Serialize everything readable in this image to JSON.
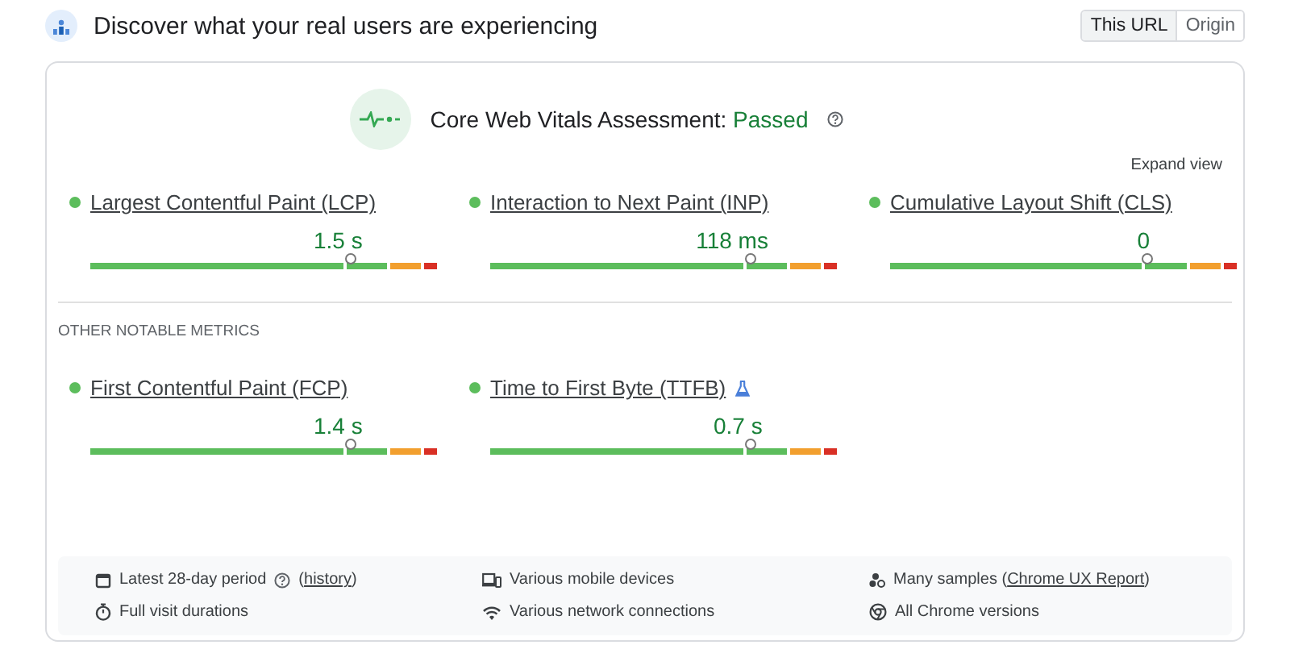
{
  "header": {
    "title": "Discover what your real users are experiencing"
  },
  "toggle": [
    {
      "label": "This URL",
      "selected": true
    },
    {
      "label": "Origin",
      "selected": false
    }
  ],
  "assessment": {
    "label": "Core Web Vitals Assessment:",
    "status": "Passed",
    "passed": true
  },
  "expand_link": "Expand view",
  "core_metrics": [
    {
      "name": "Largest Contentful Paint (LCP)",
      "value": "1.5 s",
      "color": "#5cbd5c",
      "level": 0.75
    },
    {
      "name": "Interaction to Next Paint (INP)",
      "value": "118 ms",
      "color": "#5cbd5c",
      "level": 0.75
    },
    {
      "name": "Cumulative Layout Shift (CLS)",
      "value": "0",
      "color": "#5cbd5c",
      "level": 0.74
    }
  ],
  "other_heading": "OTHER NOTABLE METRICS",
  "other_metrics": [
    {
      "name": "First Contentful Paint (FCP)",
      "value": "1.4 s",
      "color": "#5cbd5c",
      "level": 0.75,
      "experimental": false
    },
    {
      "name": "Time to First Byte (TTFB)",
      "value": "0.7 s",
      "color": "#5cbd5c",
      "level": 0.75,
      "experimental": true
    }
  ],
  "footer": [
    {
      "text": "Latest 28-day period",
      "help": true,
      "before": "(",
      "link": "history",
      "after": ")"
    },
    {
      "text": "Various mobile devices"
    },
    {
      "text": "Many samples (",
      "link": "Chrome UX Report",
      "after": ")"
    },
    {
      "text": "Full visit durations"
    },
    {
      "text": "Various network connections"
    },
    {
      "text": "All Chrome versions"
    }
  ]
}
